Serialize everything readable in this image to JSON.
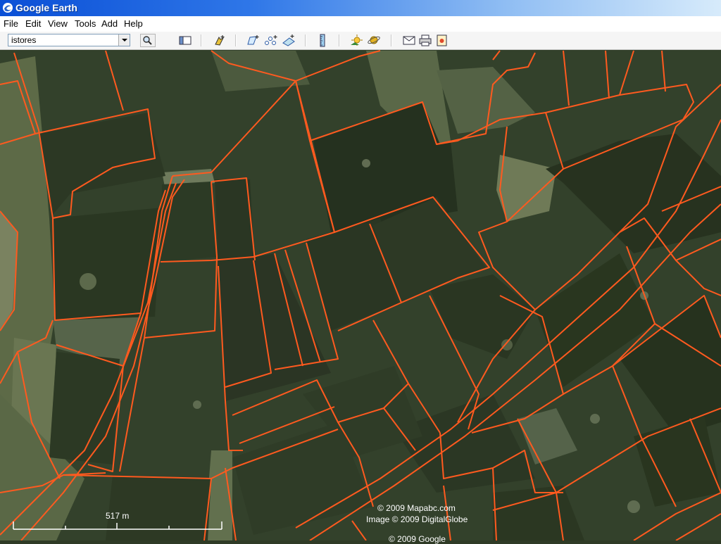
{
  "window": {
    "title": "Google Earth"
  },
  "menu": {
    "items": [
      "File",
      "Edit",
      "View",
      "Tools",
      "Add",
      "Help"
    ]
  },
  "toolbar": {
    "search_value": "istores",
    "icons": [
      "search-icon",
      "sidebar-toggle-icon",
      "placemark-icon",
      "polygon-icon",
      "path-icon",
      "image-overlay-icon",
      "ruler-icon",
      "sunlight-icon",
      "planets-icon",
      "email-icon",
      "print-icon",
      "google-maps-icon"
    ]
  },
  "map": {
    "scale_label": "517 m",
    "copyright_1": "© 2009 Mapabc.com",
    "copyright_2": "Image © 2009 DigitalGlobe",
    "copyright_3": "© 2009 Google",
    "parcel_line_color": "#ff5a1f"
  }
}
